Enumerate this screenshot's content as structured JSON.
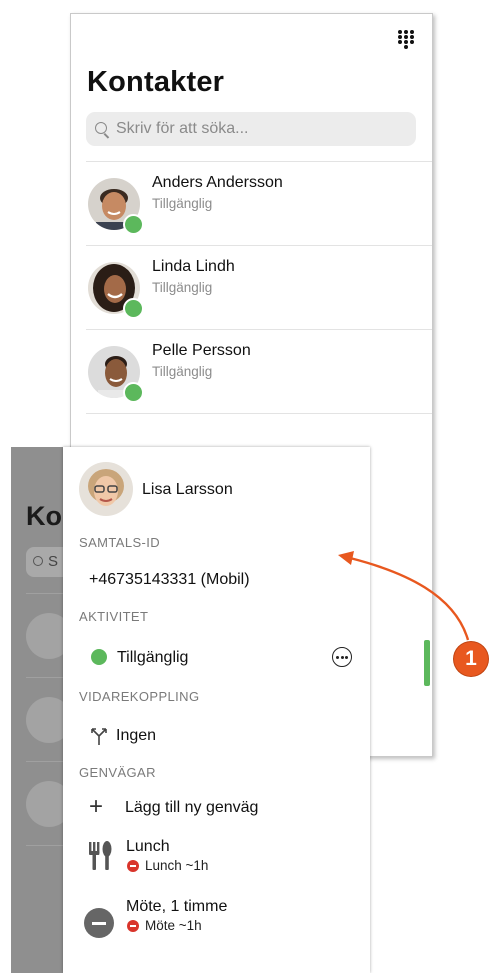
{
  "contacts_screen": {
    "title": "Kontakter",
    "search_placeholder": "Skriv för att söka...",
    "dialpad_icon": "dialpad-icon",
    "contacts": [
      {
        "name": "Anders Andersson",
        "status": "Tillgänglig",
        "status_color": "#5cb85c"
      },
      {
        "name": "Linda Lindh",
        "status": "Tillgänglig",
        "status_color": "#5cb85c"
      },
      {
        "name": "Pelle Persson",
        "status": "Tillgänglig",
        "status_color": "#5cb85c"
      }
    ]
  },
  "behind_panel": {
    "title_fragment": "Ko",
    "search_fragment": "S"
  },
  "profile_panel": {
    "user_name": "Lisa Larsson",
    "sections": {
      "call_id": "SAMTALS-ID",
      "activity": "AKTIVITET",
      "forwarding": "VIDAREKOPPLING",
      "shortcuts": "GENVÄGAR"
    },
    "call_id_value": "+46735143331 (Mobil)",
    "activity_value": "Tillgänglig",
    "forwarding_value": "Ingen",
    "shortcuts": {
      "add_label": "Lägg till ny genväg",
      "items": [
        {
          "title": "Lunch",
          "detail": "Lunch ~1h",
          "icon": "fork-knife-icon"
        },
        {
          "title": "Möte, 1 timme",
          "detail": "Möte ~1h",
          "icon": "minus-circle-icon"
        }
      ]
    }
  },
  "callout": {
    "number": "1",
    "color": "#e8581f"
  },
  "colors": {
    "available": "#5cb85c",
    "busy": "#d9342b",
    "accent": "#e8581f"
  }
}
